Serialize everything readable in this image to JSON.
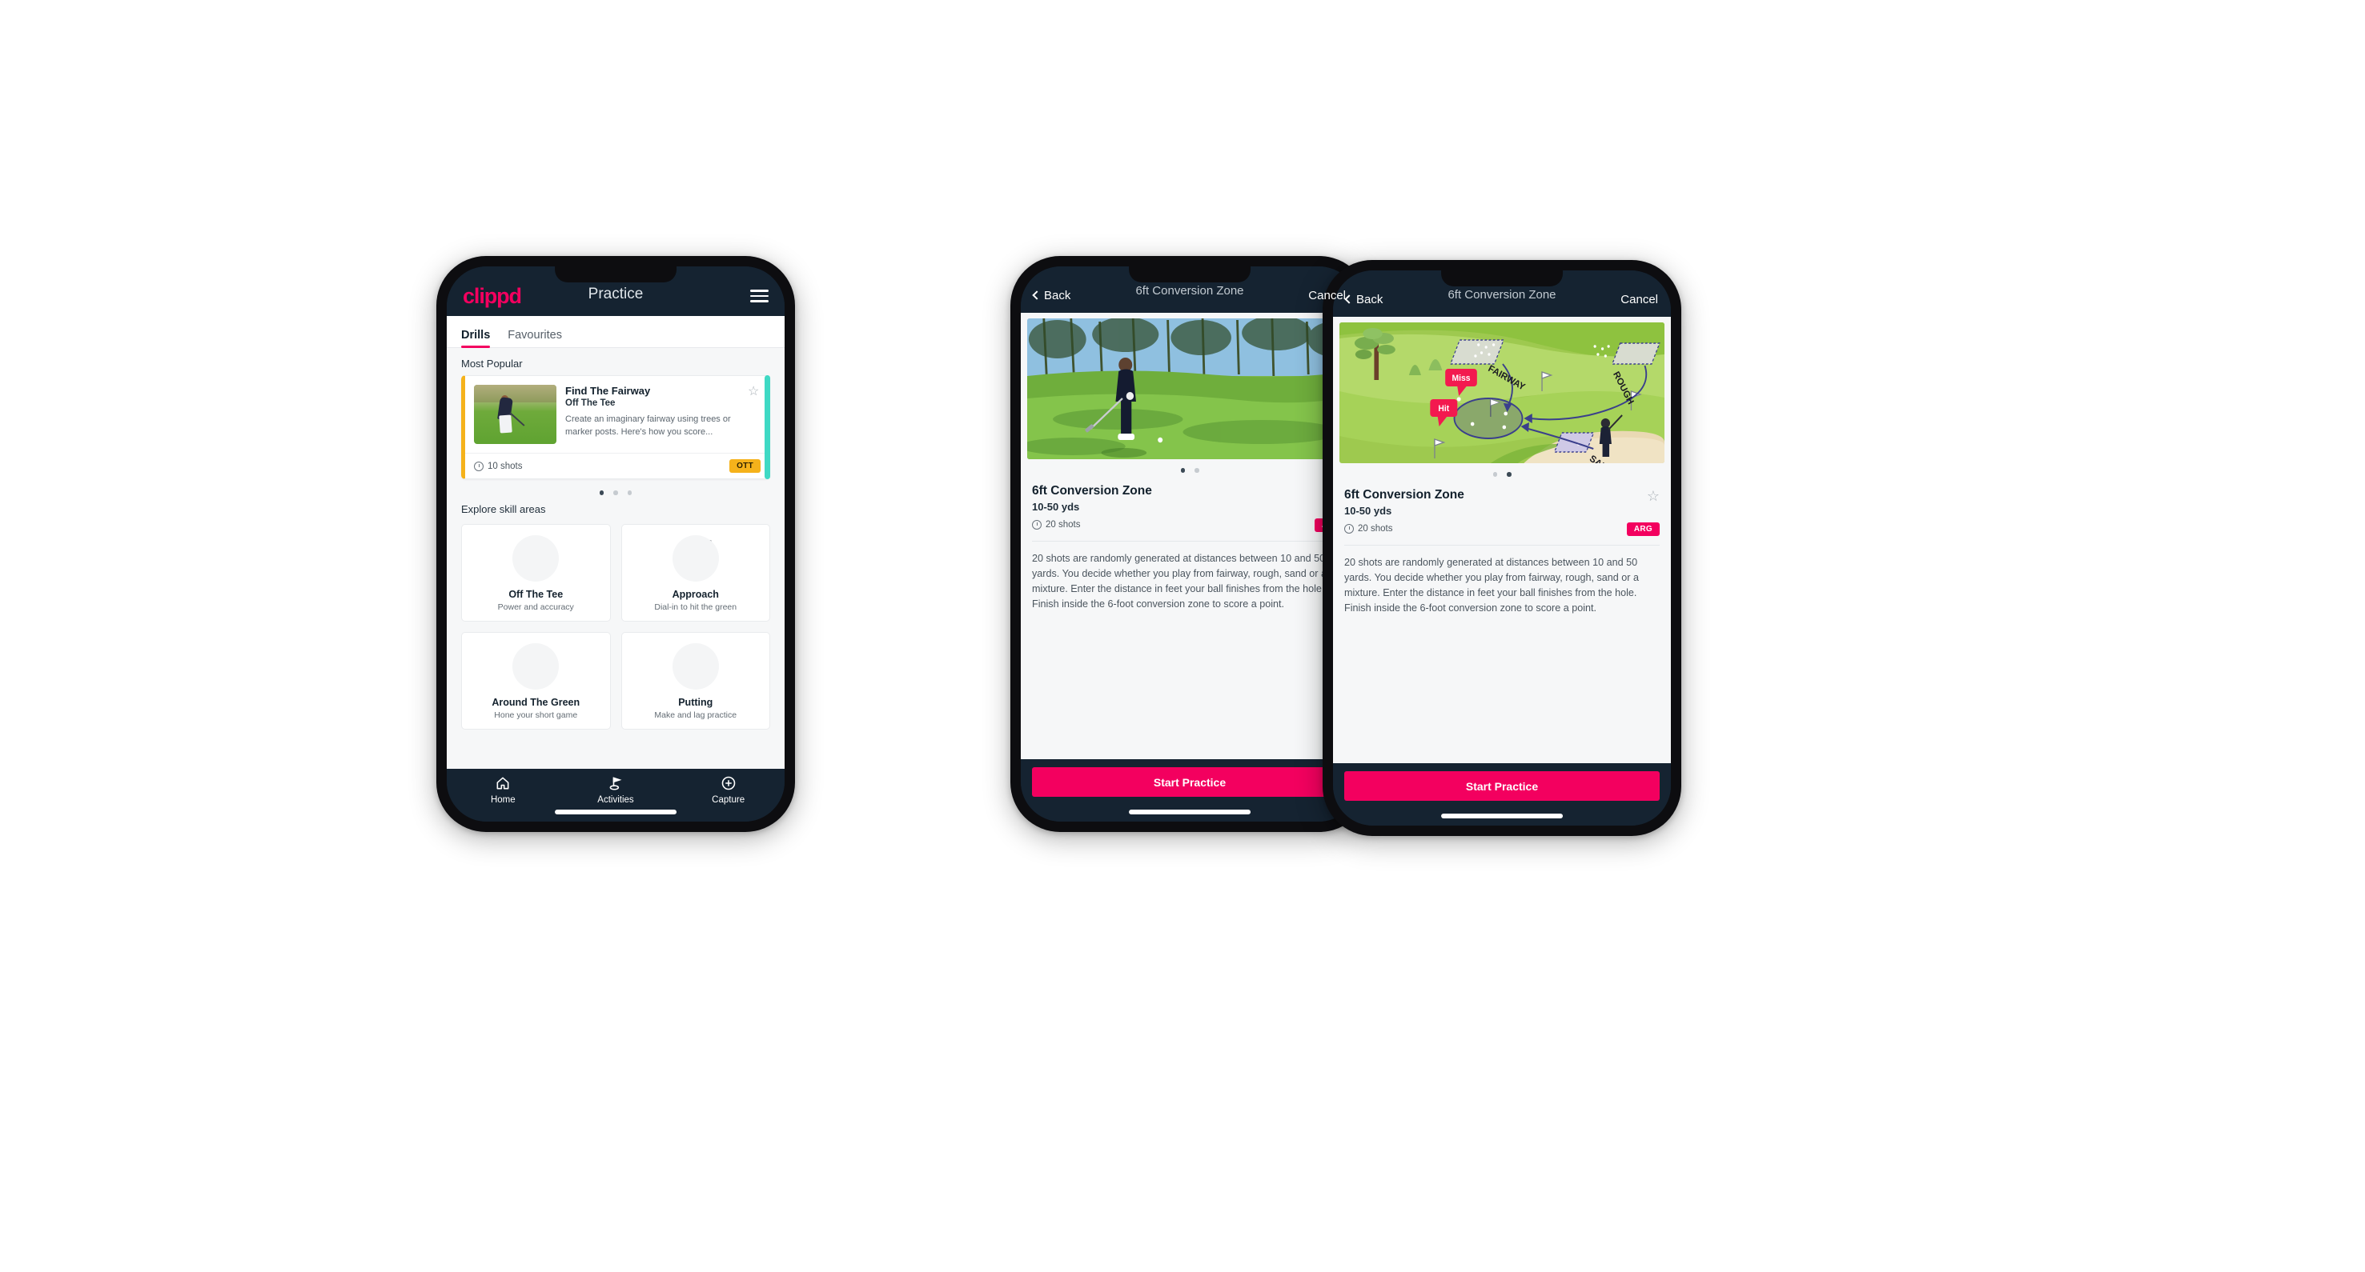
{
  "phone1": {
    "header": {
      "logo": "clippd",
      "title": "Practice",
      "menu_icon": "hamburger-icon"
    },
    "tabs": [
      {
        "label": "Drills",
        "active": true
      },
      {
        "label": "Favourites",
        "active": false
      }
    ],
    "section_most_popular": "Most Popular",
    "drill_card": {
      "title": "Find The Fairway",
      "subtitle": "Off The Tee",
      "description": "Create an imaginary fairway using trees or marker posts. Here's how you score...",
      "shots": "10 shots",
      "badge": "OTT",
      "badge_color": "#f5b21b",
      "star_icon": "star-outline-icon",
      "clock_icon": "clock-icon"
    },
    "carousel_dots": {
      "count": 3,
      "active_index": 0
    },
    "section_skill_areas": "Explore skill areas",
    "skill_areas": [
      {
        "name": "Off The Tee",
        "desc": "Power and accuracy",
        "accent": "#f5b21b",
        "icon": "tee-fan-icon"
      },
      {
        "name": "Approach",
        "desc": "Dial-in to hit the green",
        "accent": "#2ed3bb",
        "icon": "green-approach-icon"
      },
      {
        "name": "Around The Green",
        "desc": "Hone your short game",
        "accent": "#f3005f",
        "icon": "chip-green-icon"
      },
      {
        "name": "Putting",
        "desc": "Make and lag practice",
        "accent": "#9b30d9",
        "icon": "putting-rings-icon"
      }
    ],
    "bottom_nav": [
      {
        "label": "Home",
        "icon": "home-icon",
        "active": false
      },
      {
        "label": "Activities",
        "icon": "golf-flag-icon",
        "active": true
      },
      {
        "label": "Capture",
        "icon": "plus-circle-icon",
        "active": false
      }
    ]
  },
  "detail": {
    "nav": {
      "back": "Back",
      "title": "6ft Conversion Zone",
      "cancel": "Cancel",
      "back_icon": "chevron-left-icon"
    },
    "name": "6ft Conversion Zone",
    "yards": "10-50 yds",
    "shots": "20 shots",
    "badge": "ARG",
    "badge_color": "#f3005f",
    "star_icon": "star-outline-icon",
    "clock_icon": "clock-icon",
    "description": "20 shots are randomly generated at distances between 10 and 50 yards. You decide whether you play from fairway, rough, sand or a mixture. Enter the distance in feet your ball finishes from the hole. Finish inside the 6-foot conversion zone to score a point.",
    "cta": "Start Practice"
  },
  "phone2": {
    "media_type": "video-thumbnail",
    "carousel_dots": {
      "count": 2,
      "active_index": 0
    }
  },
  "phone3": {
    "media_type": "course-diagram",
    "carousel_dots": {
      "count": 2,
      "active_index": 1
    },
    "diagram_labels": {
      "fairway": "FAIRWAY",
      "rough": "ROUGH",
      "sand": "SAND",
      "miss": "Miss",
      "hit": "Hit"
    }
  },
  "colors": {
    "brand_pink": "#f3005f",
    "header_navy": "#152331",
    "ott_yellow": "#f5b21b",
    "teal": "#3fd9c4",
    "page_bg": "#f6f7f8"
  }
}
